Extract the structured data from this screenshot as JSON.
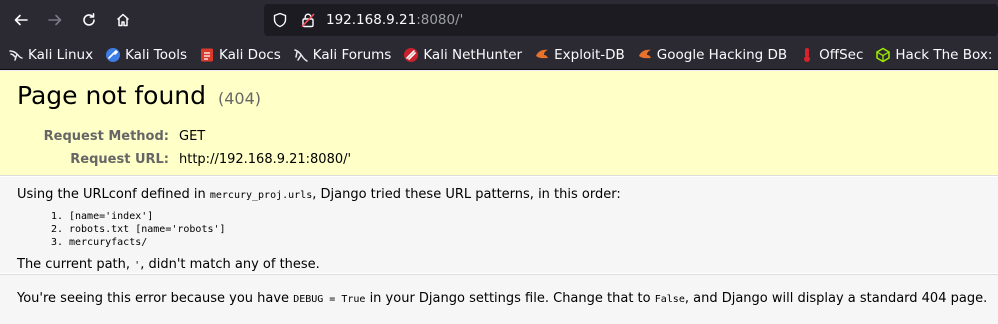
{
  "browser": {
    "url_host": "192.168.9.21",
    "url_rest": ":8080/'",
    "bookmarks": [
      {
        "label": "Kali Linux",
        "icon": "kali-dragon-icon"
      },
      {
        "label": "Kali Tools",
        "icon": "kali-tools-icon"
      },
      {
        "label": "Kali Docs",
        "icon": "kali-docs-icon"
      },
      {
        "label": "Kali Forums",
        "icon": "kali-forums-icon"
      },
      {
        "label": "Kali NetHunter",
        "icon": "nethunter-icon"
      },
      {
        "label": "Exploit-DB",
        "icon": "exploit-db-icon"
      },
      {
        "label": "Google Hacking DB",
        "icon": "ghdb-icon"
      },
      {
        "label": "OffSec",
        "icon": "offsec-icon"
      },
      {
        "label": "Hack The Box: Ha",
        "icon": "htb-icon"
      }
    ]
  },
  "error": {
    "title": "Page not found",
    "code": "(404)",
    "method_label": "Request Method:",
    "method": "GET",
    "url_label": "Request URL:",
    "url": "http://192.168.9.21:8080/'"
  },
  "info": {
    "urlconf_pre": "Using the URLconf defined in ",
    "urlconf_module": "mercury_proj.urls",
    "urlconf_post": ", Django tried these URL patterns, in this order:",
    "patterns": [
      "[name='index']",
      "robots.txt [name='robots']",
      "mercuryfacts/"
    ],
    "current_pre": "The current path, ",
    "current_path": "'",
    "current_post": ", didn't match any of these."
  },
  "explanation": {
    "pre": "You're seeing this error because you have ",
    "debug": "DEBUG = True",
    "mid": " in your Django settings file. Change that to ",
    "false": "False",
    "post": ", and Django will display a standard 404 page."
  }
}
